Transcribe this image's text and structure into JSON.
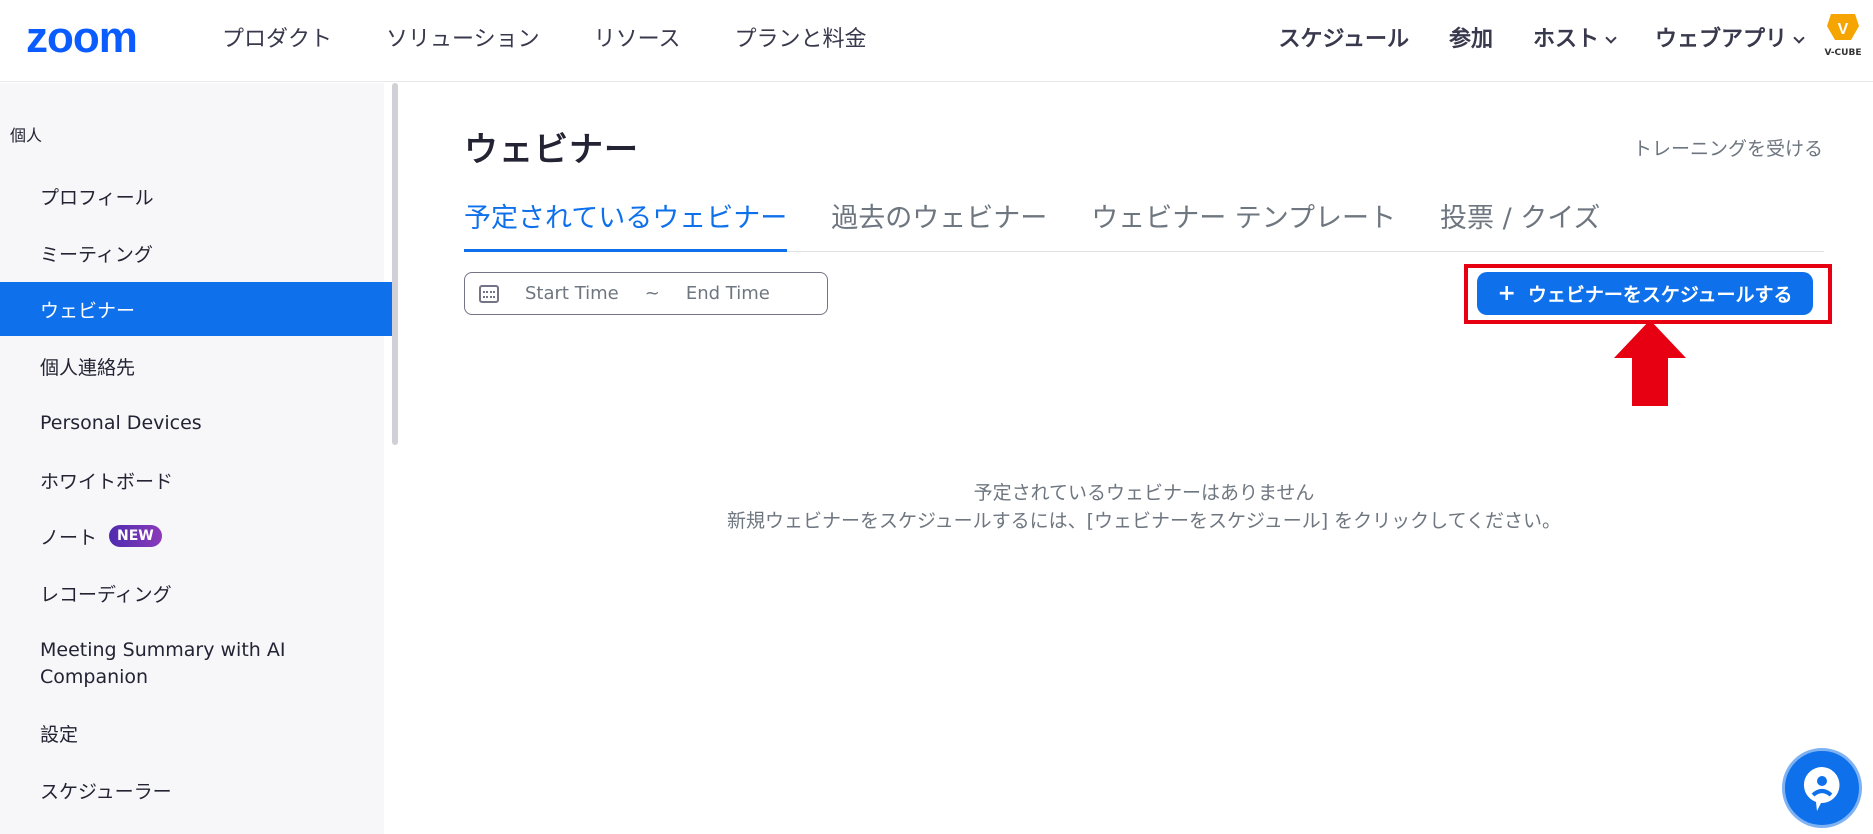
{
  "header": {
    "logo_text": "zoom",
    "nav_left": [
      "プロダクト",
      "ソリューション",
      "リソース",
      "プランと料金"
    ],
    "nav_right": {
      "schedule": "スケジュール",
      "join": "参加",
      "host": "ホスト",
      "webapp": "ウェブアプリ"
    },
    "partner_logo_text": "V-CUBE"
  },
  "sidebar": {
    "section": "個人",
    "items": [
      {
        "label": "プロフィール"
      },
      {
        "label": "ミーティング"
      },
      {
        "label": "ウェビナー"
      },
      {
        "label": "個人連絡先"
      },
      {
        "label": "Personal Devices"
      },
      {
        "label": "ホワイトボード"
      },
      {
        "label": "ノート",
        "badge": "NEW"
      },
      {
        "label": "レコーディング"
      },
      {
        "label": "Meeting Summary with AI Companion"
      },
      {
        "label": "設定"
      },
      {
        "label": "スケジューラー"
      }
    ]
  },
  "main": {
    "title": "ウェビナー",
    "training_link": "トレーニングを受ける",
    "tabs": [
      "予定されているウェビナー",
      "過去のウェビナー",
      "ウェビナー テンプレート",
      "投票 / クイズ"
    ],
    "date_range": {
      "start": "Start Time",
      "separator": "~",
      "end": "End Time"
    },
    "schedule_button": "ウェビナーをスケジュールする",
    "schedule_button_icon": "+",
    "empty_title": "予定されているウェビナーはありません",
    "empty_desc": "新規ウェビナーをスケジュールするには、[ウェビナーをスケジュール] をクリックしてください。"
  },
  "colors": {
    "brand": "#0e71eb",
    "annotation": "#e60012"
  }
}
